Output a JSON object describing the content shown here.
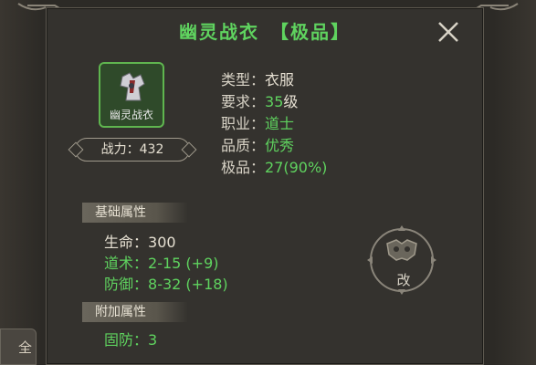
{
  "item": {
    "title": "幽灵战衣　【极品】",
    "icon_name": "幽灵战衣",
    "power_label": "战力：",
    "power_value": "432"
  },
  "info": [
    {
      "key": "类型：",
      "value": "衣服"
    },
    {
      "key": "要求：",
      "value_green": "35",
      "value_white": "级"
    },
    {
      "key": "职业：",
      "value_green": "道士"
    },
    {
      "key": "品质：",
      "value_green": "优秀"
    },
    {
      "key": "极品：",
      "value_green": "27(90%)"
    }
  ],
  "base_section": {
    "header": "基础属性",
    "stats": [
      {
        "label": "生命：",
        "value": "300",
        "bonus": ""
      },
      {
        "label": "道术：",
        "value": "2-15",
        "bonus": "(+9)"
      },
      {
        "label": "防御：",
        "value": "8-32",
        "bonus": "(+18)"
      }
    ]
  },
  "extra_section": {
    "header": "附加属性",
    "stats": [
      {
        "label": "固防：",
        "value": "3"
      }
    ]
  },
  "emblem_label": "改",
  "left_tab_label": "全",
  "colors": {
    "accent_green": "#5fd35f",
    "panel_bg": "#34322e",
    "text": "#e6e0d2"
  }
}
